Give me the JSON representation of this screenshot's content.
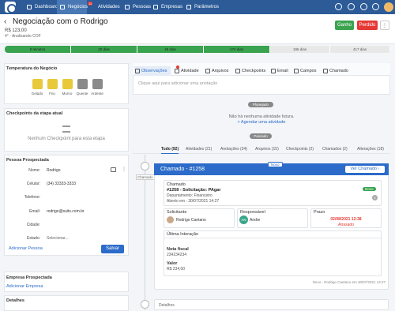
{
  "nav": {
    "items": [
      {
        "label": "Dashboard"
      },
      {
        "label": "Negócios"
      },
      {
        "label": "Atividades",
        "badge": "12"
      },
      {
        "label": "Pessoas"
      },
      {
        "label": "Empresas"
      },
      {
        "label": "Parâmetros"
      }
    ]
  },
  "deal": {
    "back": "‹",
    "title": "Negociação com o Rodrigo",
    "value": "R$ 123,00",
    "stage": "4° - Analisando COF",
    "won_label": "Ganho",
    "lost_label": "Perdido"
  },
  "pipeline": [
    {
      "label": "0 minutos",
      "done": true
    },
    {
      "label": "20 dias",
      "done": true
    },
    {
      "label": "45 dias",
      "done": true
    },
    {
      "label": "174 dias",
      "done": true
    },
    {
      "label": "196 dias",
      "done": false
    },
    {
      "label": "417 dias",
      "done": false
    }
  ],
  "temperature": {
    "title": "Temperatura do Negócio",
    "levels": [
      {
        "label": "Gelado",
        "color": "#e8c93a"
      },
      {
        "label": "Frio",
        "color": "#e8c93a"
      },
      {
        "label": "Morno",
        "color": "#e8c93a"
      },
      {
        "label": "Quente",
        "color": "#8a8a8a"
      },
      {
        "label": "Ardente",
        "color": "#8a8a8a"
      }
    ]
  },
  "checkpoints": {
    "title": "Checkpoints da etapa atual",
    "empty": "Nenhum Checkpoint para esta etapa"
  },
  "person": {
    "title": "Pessoa Prospectada",
    "fields": [
      {
        "label": "Nome:",
        "value": "Rodrigo"
      },
      {
        "label": "Celular:",
        "value": "(34) 33333-3333"
      },
      {
        "label": "Telefone:",
        "value": ""
      },
      {
        "label": "Email:",
        "value": "rodrigo@suits.com.br"
      },
      {
        "label": "Cidade:",
        "value": ""
      },
      {
        "label": "Estado:",
        "value": "Selecionar..."
      }
    ],
    "add_link": "Adicionar Pessoa",
    "save_label": "Salvar"
  },
  "company": {
    "title": "Empresa Prospectada",
    "add_link": "Adicionar Empresa"
  },
  "details": {
    "title": "Detalhes"
  },
  "tabs": [
    {
      "label": "Observações",
      "icon": "note-icon"
    },
    {
      "label": "Atividade",
      "icon": "calendar-icon"
    },
    {
      "label": "Arquivos",
      "icon": "paperclip-icon"
    },
    {
      "label": "Checkpoints",
      "icon": "checklist-icon"
    },
    {
      "label": "Email",
      "icon": "envelope-icon"
    },
    {
      "label": "Campos",
      "icon": "wrench-icon"
    },
    {
      "label": "Chamado",
      "icon": "ticket-icon"
    }
  ],
  "note_placeholder": "Clique aqui para adicionar uma anotação",
  "planned": {
    "pill": "Planejado",
    "empty": "Não há nenhuma atividade futura.",
    "add_link": "+ Agendar uma atividade"
  },
  "past_pill": "Passado",
  "filters": [
    {
      "label": "Tudo (92)"
    },
    {
      "label": "Atividades (21)"
    },
    {
      "label": "Anotações (34)"
    },
    {
      "label": "Arquivos (15)"
    },
    {
      "label": "Checkpoints (2)"
    },
    {
      "label": "Chamados (2)"
    },
    {
      "label": "Alterações (18)"
    }
  ],
  "ticket": {
    "timeline_label": "Chamado",
    "new_badge": "Novo",
    "header": "Chamado - #1258",
    "view_button": "Ver Chamado",
    "section_title": "Chamado",
    "name": "#1258 - Solicitação: PAgar",
    "department": "Departamento: Financeiro",
    "opened": "Aberto em : 30/07/2021 14:27",
    "status_badge": "Novo",
    "requester_label": "Solicitante",
    "requester_name": "Rodrigo Caetano",
    "assignee_label": "Responsável",
    "assignee_initials": "AN",
    "assignee_name": "Andre",
    "deadline_label": "Prazo",
    "deadline": "02/08/2021 12:38",
    "deadline_status": "Atrasado",
    "interaction_title": "Última Interação",
    "field1_label": "Nota fiscal",
    "field1_value": "234234234",
    "field2_label": "Valor",
    "field2_value": "R$ 234,00",
    "footer": "Novo - Rodrigo Caetano em 30/07/2021 14:27"
  },
  "next_timeline_label": "Detalhes",
  "colors": {
    "nav": "#2c5b98",
    "won": "#3aa34f",
    "lost": "#e53935",
    "ticket_header": "#2c6bc9"
  }
}
